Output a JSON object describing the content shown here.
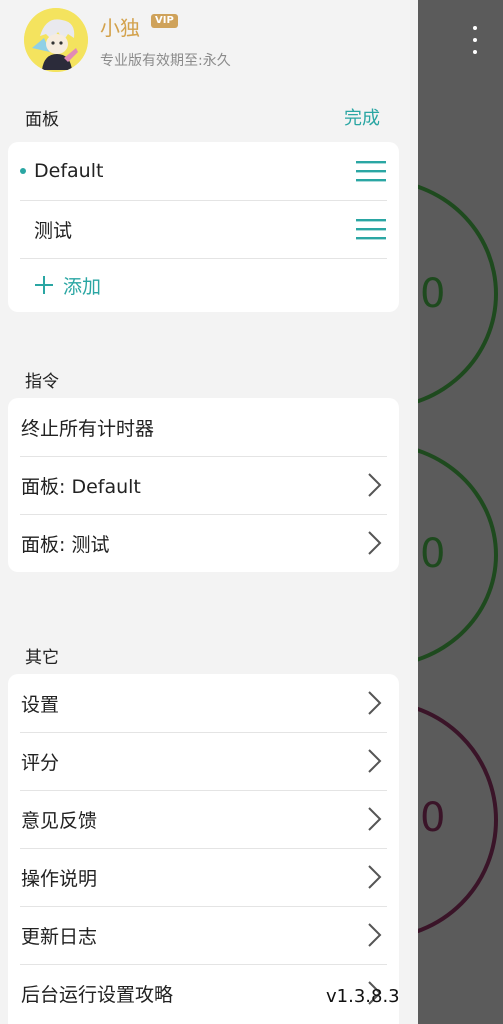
{
  "profile": {
    "username": "小独",
    "vip_badge": "VIP",
    "subscription": "专业版有效期至:永久"
  },
  "panels": {
    "section_title": "面板",
    "done_label": "完成",
    "items": [
      {
        "label": "Default",
        "active": true
      },
      {
        "label": "测试",
        "active": false
      }
    ],
    "add_label": "添加"
  },
  "commands": {
    "section_title": "指令",
    "items": [
      {
        "label": "终止所有计时器"
      },
      {
        "label": "面板: Default"
      },
      {
        "label": "面板: 测试"
      }
    ]
  },
  "others": {
    "section_title": "其它",
    "items": [
      {
        "label": "设置"
      },
      {
        "label": "评分"
      },
      {
        "label": "意见反馈"
      },
      {
        "label": "操作说明"
      },
      {
        "label": "更新日志"
      },
      {
        "label": "后台运行设置攻略"
      }
    ]
  },
  "version": "v1.3.8.3",
  "background": {
    "timer_labels": [
      "0",
      "0",
      "0"
    ],
    "ring_colors": [
      "#1e4a1e",
      "#1e4a1e",
      "#3a1428"
    ]
  },
  "colors": {
    "accent": "#2aa6a3",
    "vip": "#cfa25a",
    "drawer_bg": "#f3f3f3",
    "overlay": "#5b5b5b"
  },
  "icons": [
    "hamburger-icon",
    "chevron-right-icon",
    "plus-icon",
    "more-vert-icon"
  ]
}
